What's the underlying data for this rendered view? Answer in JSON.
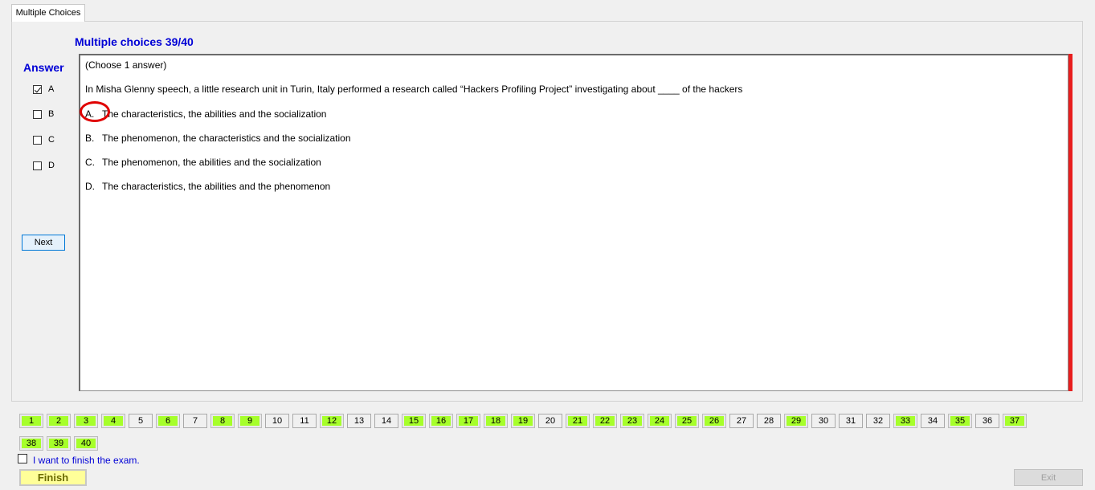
{
  "tab": {
    "label": "Multiple Choices"
  },
  "question": {
    "title": "Multiple choices 39/40",
    "instruction": "(Choose 1 answer)",
    "text": "In Misha Glenny speech, a little research unit in Turin, Italy performed a research called “Hackers Profiling Project” investigating about ____ of the hackers",
    "options": [
      {
        "letter": "A.",
        "text": "The characteristics, the abilities and the socialization"
      },
      {
        "letter": "B.",
        "text": "The phenomenon, the characteristics and the socialization"
      },
      {
        "letter": "C.",
        "text": "The phenomenon, the abilities and the socialization"
      },
      {
        "letter": "D.",
        "text": "The characteristics, the abilities and the phenomenon"
      }
    ]
  },
  "answer_panel": {
    "label": "Answer",
    "choices": [
      {
        "letter": "A",
        "checked": true
      },
      {
        "letter": "B",
        "checked": false
      },
      {
        "letter": "C",
        "checked": false
      },
      {
        "letter": "D",
        "checked": false
      }
    ],
    "next_label": "Next"
  },
  "navigator": {
    "answered_color": "#a6ff2a",
    "buttons": [
      {
        "n": "1",
        "answered": true
      },
      {
        "n": "2",
        "answered": true
      },
      {
        "n": "3",
        "answered": true
      },
      {
        "n": "4",
        "answered": true
      },
      {
        "n": "5",
        "answered": false
      },
      {
        "n": "6",
        "answered": true
      },
      {
        "n": "7",
        "answered": false
      },
      {
        "n": "8",
        "answered": true
      },
      {
        "n": "9",
        "answered": true
      },
      {
        "n": "10",
        "answered": false
      },
      {
        "n": "11",
        "answered": false
      },
      {
        "n": "12",
        "answered": true
      },
      {
        "n": "13",
        "answered": false
      },
      {
        "n": "14",
        "answered": false
      },
      {
        "n": "15",
        "answered": true
      },
      {
        "n": "16",
        "answered": true
      },
      {
        "n": "17",
        "answered": true
      },
      {
        "n": "18",
        "answered": true
      },
      {
        "n": "19",
        "answered": true
      },
      {
        "n": "20",
        "answered": false
      },
      {
        "n": "21",
        "answered": true
      },
      {
        "n": "22",
        "answered": true
      },
      {
        "n": "23",
        "answered": true
      },
      {
        "n": "24",
        "answered": true
      },
      {
        "n": "25",
        "answered": true
      },
      {
        "n": "26",
        "answered": true
      },
      {
        "n": "27",
        "answered": false
      },
      {
        "n": "28",
        "answered": false
      },
      {
        "n": "29",
        "answered": true
      },
      {
        "n": "30",
        "answered": false
      },
      {
        "n": "31",
        "answered": false
      },
      {
        "n": "32",
        "answered": false
      },
      {
        "n": "33",
        "answered": true
      },
      {
        "n": "34",
        "answered": false
      },
      {
        "n": "35",
        "answered": true
      },
      {
        "n": "36",
        "answered": false
      },
      {
        "n": "37",
        "answered": true
      },
      {
        "n": "38",
        "answered": true
      },
      {
        "n": "39",
        "answered": true
      },
      {
        "n": "40",
        "answered": true
      }
    ]
  },
  "footer": {
    "finish_checkbox_label": "I want to finish the exam.",
    "finish_label": "Finish",
    "exit_label": "Exit"
  },
  "colors": {
    "accent_blue": "#0000d6",
    "marker_red": "#e00000"
  }
}
